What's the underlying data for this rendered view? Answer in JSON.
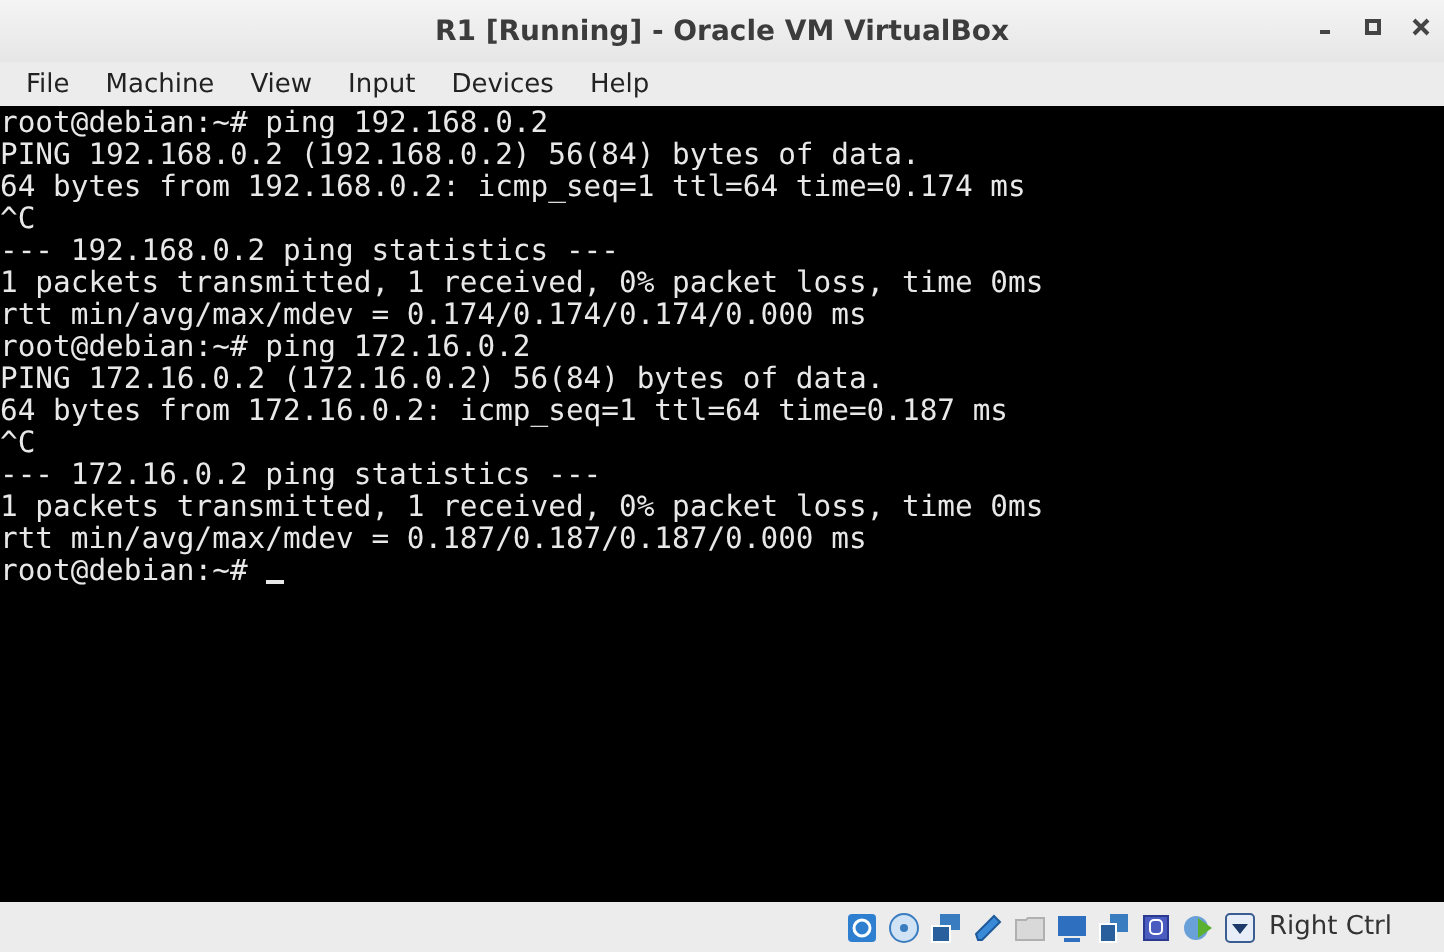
{
  "window": {
    "title": "R1 [Running] - Oracle VM VirtualBox"
  },
  "menu": [
    "File",
    "Machine",
    "View",
    "Input",
    "Devices",
    "Help"
  ],
  "terminal": {
    "lines": [
      "root@debian:~# ping 192.168.0.2",
      "PING 192.168.0.2 (192.168.0.2) 56(84) bytes of data.",
      "64 bytes from 192.168.0.2: icmp_seq=1 ttl=64 time=0.174 ms",
      "^C",
      "--- 192.168.0.2 ping statistics ---",
      "1 packets transmitted, 1 received, 0% packet loss, time 0ms",
      "rtt min/avg/max/mdev = 0.174/0.174/0.174/0.000 ms",
      "root@debian:~# ping 172.16.0.2",
      "PING 172.16.0.2 (172.16.0.2) 56(84) bytes of data.",
      "64 bytes from 172.16.0.2: icmp_seq=1 ttl=64 time=0.187 ms",
      "^C",
      "--- 172.16.0.2 ping statistics ---",
      "1 packets transmitted, 1 received, 0% packet loss, time 0ms",
      "rtt min/avg/max/mdev = 0.187/0.187/0.187/0.000 ms",
      "root@debian:~#"
    ],
    "cursor": true
  },
  "status_bar": {
    "host_key": "Right Ctrl"
  }
}
